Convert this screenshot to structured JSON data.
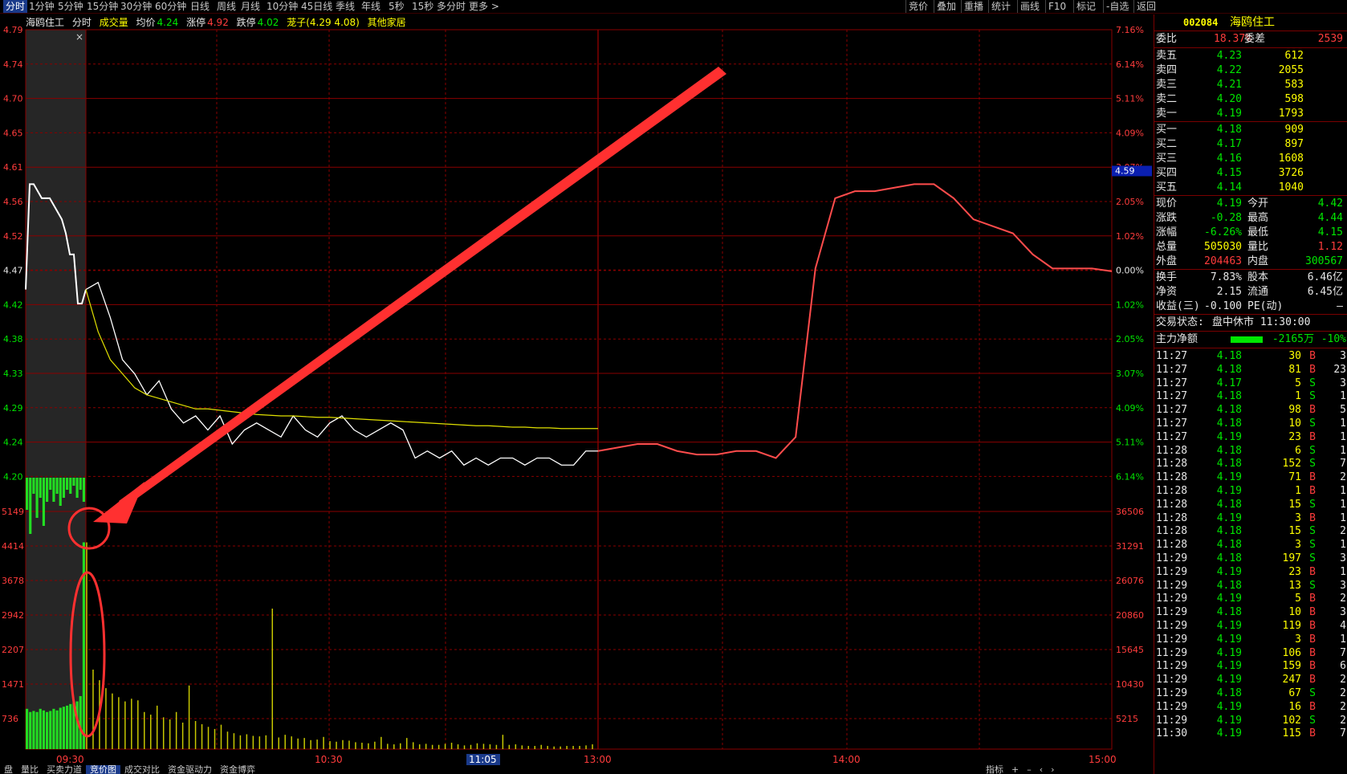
{
  "topbar": {
    "periods": [
      "分时",
      "1分钟",
      "5分钟",
      "15分钟",
      "30分钟",
      "60分钟",
      "日线",
      "周线",
      "月线",
      "10分钟",
      "45日线",
      "季线",
      "年线",
      "5秒",
      "15秒",
      "多分时",
      "更多 >"
    ],
    "selected": "分时",
    "right_tools": [
      "竞价",
      "叠加",
      "重播",
      "统计",
      "画线",
      "F10",
      "标记",
      "-自选",
      "返回"
    ]
  },
  "legend": {
    "name": "海鸥住工",
    "mode": "分时",
    "vol_label": "成交量",
    "avg_label": "均价",
    "avg_value": "4.24",
    "up_label": "涨停",
    "up_value": "4.92",
    "down_label": "跌停",
    "down_value": "4.02",
    "cmp_label": "茏子(4.29 4.08)",
    "other_label": "其他家居"
  },
  "chart_data": {
    "type": "line",
    "title": "",
    "time_labels": [
      "09:30",
      "10:30",
      "11:05",
      "13:00",
      "14:00",
      "15:00"
    ],
    "price_axis_left": [
      "4.79",
      "4.74",
      "4.70",
      "4.65",
      "4.61",
      "4.56",
      "4.52",
      "4.47",
      "4.42",
      "4.38",
      "4.33",
      "4.29",
      "4.24",
      "4.20"
    ],
    "pct_axis_right": [
      "7.16%",
      "6.14%",
      "5.11%",
      "4.09%",
      "3.07%",
      "2.05%",
      "1.02%",
      "0.00%",
      "1.02%",
      "2.05%",
      "3.07%",
      "4.09%",
      "5.11%",
      "6.14%"
    ],
    "price_marker": "4.59",
    "vol_axis_left": [
      "5149",
      "4414",
      "3678",
      "2942",
      "2207",
      "1471",
      "736"
    ],
    "vol_axis_right": [
      "36506",
      "31291",
      "26076",
      "20860",
      "15645",
      "10430",
      "5215"
    ],
    "prev_close": 4.47,
    "price_series": [
      4.42,
      4.43,
      4.38,
      4.32,
      4.3,
      4.27,
      4.29,
      4.25,
      4.23,
      4.24,
      4.22,
      4.24,
      4.2,
      4.22,
      4.23,
      4.22,
      4.21,
      4.24,
      4.22,
      4.21,
      4.23,
      4.24,
      4.22,
      4.21,
      4.22,
      4.23,
      4.22,
      4.18,
      4.19,
      4.18,
      4.19,
      4.17,
      4.18,
      4.17,
      4.18,
      4.18,
      4.17,
      4.18,
      4.18,
      4.17,
      4.17,
      4.19,
      4.19
    ],
    "avg_series": [
      4.42,
      4.36,
      4.32,
      4.3,
      4.28,
      4.27,
      4.265,
      4.26,
      4.255,
      4.25,
      4.25,
      4.248,
      4.246,
      4.244,
      4.242,
      4.241,
      4.24,
      4.24,
      4.239,
      4.238,
      4.238,
      4.237,
      4.236,
      4.235,
      4.234,
      4.233,
      4.232,
      4.231,
      4.23,
      4.229,
      4.228,
      4.227,
      4.226,
      4.226,
      4.225,
      4.224,
      4.224,
      4.223,
      4.223,
      4.222,
      4.222,
      4.222,
      4.222
    ],
    "other_series": [
      4.19,
      4.195,
      4.2,
      4.2,
      4.19,
      4.185,
      4.185,
      4.19,
      4.19,
      4.18,
      4.21,
      4.45,
      4.55,
      4.56,
      4.56,
      4.565,
      4.57,
      4.57,
      4.55,
      4.52,
      4.51,
      4.5,
      4.47,
      4.45,
      4.45,
      4.45,
      4.446
    ],
    "auction_price": [
      4.42,
      4.57,
      4.57,
      4.56,
      4.55,
      4.55,
      4.55,
      4.54,
      4.53,
      4.52,
      4.5,
      4.47,
      4.47,
      4.4,
      4.4,
      4.42
    ],
    "volumes": [
      3900,
      1500,
      1300,
      1150,
      1050,
      980,
      900,
      950,
      920,
      700,
      650,
      820,
      600,
      560,
      700,
      500,
      1200,
      530,
      470,
      420,
      380,
      460,
      330,
      300,
      260,
      280,
      250,
      240,
      260,
      2650,
      220,
      270,
      240,
      200,
      210,
      170,
      180,
      230,
      150,
      140,
      170,
      160,
      130,
      120,
      110,
      140,
      230,
      100,
      90,
      110,
      210,
      130,
      90,
      100,
      80,
      80,
      100,
      120,
      90,
      70,
      80,
      110,
      100,
      90,
      80,
      270,
      80,
      90,
      70,
      60,
      60,
      80,
      60,
      50,
      50,
      60,
      60,
      60,
      70,
      90
    ],
    "auction_volumes": [
      760,
      700,
      720,
      700,
      760,
      730,
      700,
      720,
      760,
      730,
      780,
      800,
      820,
      850,
      880,
      900,
      1000,
      3900
    ]
  },
  "annotations": {
    "arrow": "red-arrow",
    "circles": [
      "vol-spike-circle",
      "auction-end-circle"
    ]
  },
  "right_panel": {
    "code": "002084",
    "name": "海鸥住工",
    "ratio_label": "委比",
    "ratio_value": "18.37%",
    "diff_label": "委差",
    "diff_value": "2539",
    "asks": [
      {
        "label": "卖五",
        "price": "4.23",
        "vol": "612"
      },
      {
        "label": "卖四",
        "price": "4.22",
        "vol": "2055"
      },
      {
        "label": "卖三",
        "price": "4.21",
        "vol": "583"
      },
      {
        "label": "卖二",
        "price": "4.20",
        "vol": "598"
      },
      {
        "label": "卖一",
        "price": "4.19",
        "vol": "1793"
      }
    ],
    "bids": [
      {
        "label": "买一",
        "price": "4.18",
        "vol": "909"
      },
      {
        "label": "买二",
        "price": "4.17",
        "vol": "897"
      },
      {
        "label": "买三",
        "price": "4.16",
        "vol": "1608"
      },
      {
        "label": "买四",
        "price": "4.15",
        "vol": "3726"
      },
      {
        "label": "买五",
        "price": "4.14",
        "vol": "1040"
      }
    ],
    "quote": [
      {
        "l1": "现价",
        "v1": "4.19",
        "c1": "green",
        "l2": "今开",
        "v2": "4.42",
        "c2": "green"
      },
      {
        "l1": "涨跌",
        "v1": "-0.28",
        "c1": "green",
        "l2": "最高",
        "v2": "4.44",
        "c2": "green"
      },
      {
        "l1": "涨幅",
        "v1": "-6.26%",
        "c1": "green",
        "l2": "最低",
        "v2": "4.15",
        "c2": "green"
      },
      {
        "l1": "总量",
        "v1": "505030",
        "c1": "yellow",
        "l2": "量比",
        "v2": "1.12",
        "c2": "red"
      },
      {
        "l1": "外盘",
        "v1": "204463",
        "c1": "red",
        "l2": "内盘",
        "v2": "300567",
        "c2": "green"
      }
    ],
    "stats": [
      {
        "l1": "换手",
        "v1": "7.83%",
        "l2": "股本",
        "v2": "6.46亿"
      },
      {
        "l1": "净资",
        "v1": "2.15",
        "l2": "流通",
        "v2": "6.45亿"
      },
      {
        "l1": "收益(三)",
        "v1": "-0.100",
        "l2": "PE(动)",
        "v2": "–"
      }
    ],
    "status_label": "交易状态:",
    "status_value": "盘中休市 11:30:00",
    "flow_label": "主力净额",
    "flow_value": "-2165万",
    "flow_pct": "-10%",
    "ticks": [
      {
        "t": "11:27",
        "p": "4.18",
        "v": "30",
        "d": "B",
        "n": "3"
      },
      {
        "t": "11:27",
        "p": "4.18",
        "v": "81",
        "d": "B",
        "n": "23"
      },
      {
        "t": "11:27",
        "p": "4.17",
        "v": "5",
        "d": "S",
        "n": "3"
      },
      {
        "t": "11:27",
        "p": "4.18",
        "v": "1",
        "d": "S",
        "n": "1"
      },
      {
        "t": "11:27",
        "p": "4.18",
        "v": "98",
        "d": "B",
        "n": "5"
      },
      {
        "t": "11:27",
        "p": "4.18",
        "v": "10",
        "d": "S",
        "n": "1"
      },
      {
        "t": "11:27",
        "p": "4.19",
        "v": "23",
        "d": "B",
        "n": "1"
      },
      {
        "t": "11:28",
        "p": "4.18",
        "v": "6",
        "d": "S",
        "n": "1"
      },
      {
        "t": "11:28",
        "p": "4.18",
        "v": "152",
        "d": "S",
        "n": "7"
      },
      {
        "t": "11:28",
        "p": "4.19",
        "v": "71",
        "d": "B",
        "n": "2"
      },
      {
        "t": "11:28",
        "p": "4.19",
        "v": "1",
        "d": "B",
        "n": "1"
      },
      {
        "t": "11:28",
        "p": "4.18",
        "v": "15",
        "d": "S",
        "n": "1"
      },
      {
        "t": "11:28",
        "p": "4.19",
        "v": "3",
        "d": "B",
        "n": "1"
      },
      {
        "t": "11:28",
        "p": "4.18",
        "v": "15",
        "d": "S",
        "n": "2"
      },
      {
        "t": "11:28",
        "p": "4.18",
        "v": "3",
        "d": "S",
        "n": "1"
      },
      {
        "t": "11:29",
        "p": "4.18",
        "v": "197",
        "d": "S",
        "n": "3"
      },
      {
        "t": "11:29",
        "p": "4.19",
        "v": "23",
        "d": "B",
        "n": "1"
      },
      {
        "t": "11:29",
        "p": "4.18",
        "v": "13",
        "d": "S",
        "n": "3"
      },
      {
        "t": "11:29",
        "p": "4.19",
        "v": "5",
        "d": "B",
        "n": "2"
      },
      {
        "t": "11:29",
        "p": "4.18",
        "v": "10",
        "d": "B",
        "n": "3"
      },
      {
        "t": "11:29",
        "p": "4.19",
        "v": "119",
        "d": "B",
        "n": "4"
      },
      {
        "t": "11:29",
        "p": "4.19",
        "v": "3",
        "d": "B",
        "n": "1"
      },
      {
        "t": "11:29",
        "p": "4.19",
        "v": "106",
        "d": "B",
        "n": "7"
      },
      {
        "t": "11:29",
        "p": "4.19",
        "v": "159",
        "d": "B",
        "n": "6"
      },
      {
        "t": "11:29",
        "p": "4.19",
        "v": "247",
        "d": "B",
        "n": "2"
      },
      {
        "t": "11:29",
        "p": "4.18",
        "v": "67",
        "d": "S",
        "n": "2"
      },
      {
        "t": "11:29",
        "p": "4.19",
        "v": "16",
        "d": "B",
        "n": "2"
      },
      {
        "t": "11:29",
        "p": "4.19",
        "v": "102",
        "d": "S",
        "n": "2"
      },
      {
        "t": "11:30",
        "p": "4.19",
        "v": "115",
        "d": "B",
        "n": "7"
      }
    ]
  },
  "bottom_tabs": {
    "items": [
      "盘",
      "量比",
      "买卖力道",
      "竞价图",
      "成交对比",
      "资金驱动力",
      "资金博弈"
    ],
    "selected": "竞价图",
    "right_items": [
      "指标",
      "+",
      "–",
      "‹",
      "›"
    ]
  },
  "colors": {
    "up": "#ff3c3c",
    "down": "#00e600",
    "price_line": "#ffffff",
    "avg_line": "#e0e000",
    "other_line": "#ff4c4c",
    "grid": "#8a0000",
    "volume": "#c8c800",
    "auction_vol": "#22dd22"
  }
}
